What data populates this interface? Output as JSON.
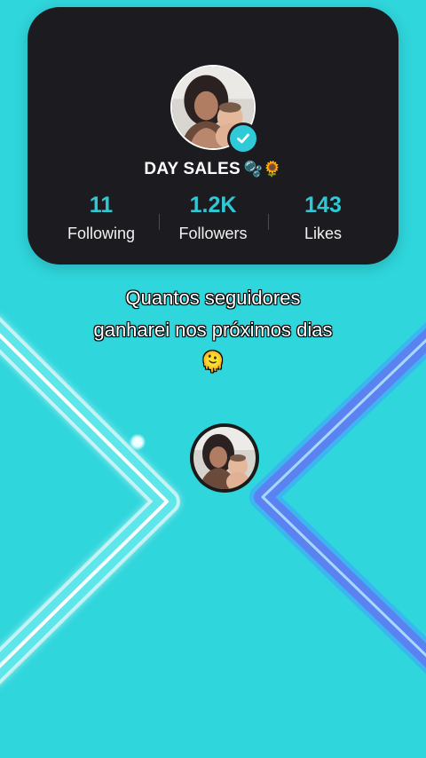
{
  "profile": {
    "username": "DAY SALES",
    "username_emojis": "🫧🌻",
    "verified": true,
    "stats": [
      {
        "value": "11",
        "label": "Following"
      },
      {
        "value": "1.2K",
        "label": "Followers"
      },
      {
        "value": "143",
        "label": "Likes"
      }
    ]
  },
  "question": {
    "line1": "Quantos seguidores",
    "line2": "ganharei nos próximos dias",
    "emoji": "🫠"
  },
  "colors": {
    "background": "#2fd6dc",
    "card": "#1c1b1f",
    "accent": "#2fc9d6",
    "right_bar": "#5a82f0"
  }
}
